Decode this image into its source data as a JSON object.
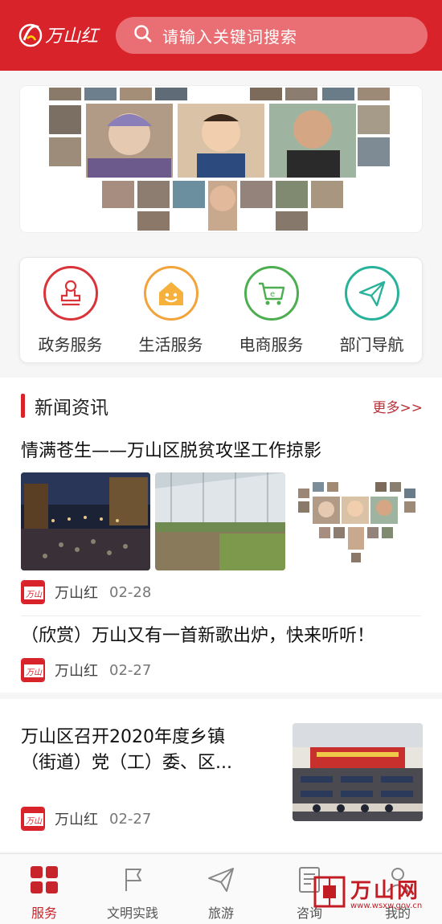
{
  "header": {
    "logo_text": "万山红",
    "search_placeholder": "请输入关键词搜索"
  },
  "services": [
    {
      "label": "政务服务",
      "icon": "stamp-icon",
      "color": "#d8343a"
    },
    {
      "label": "生活服务",
      "icon": "home-smile-icon",
      "color": "#f2a33a"
    },
    {
      "label": "电商服务",
      "icon": "cart-icon",
      "color": "#4cae4f"
    },
    {
      "label": "部门导航",
      "icon": "paper-plane-icon",
      "color": "#29b29a"
    }
  ],
  "news": {
    "section_title": "新闻资讯",
    "more_label": "更多>>",
    "articles": [
      {
        "title": "情满苍生——万山区脱贫攻坚工作掠影",
        "source": "万山红",
        "date": "02-28"
      },
      {
        "title": "（欣赏）万山又有一首新歌出炉，快来听听！",
        "source": "万山红",
        "date": "02-27"
      },
      {
        "title_line1": "万山区召开2020年度乡镇",
        "title_line2": "（街道）党（工）委、区...",
        "source": "万山红",
        "date": "02-27"
      }
    ]
  },
  "tabs": [
    {
      "label": "服务",
      "icon": "grid-icon",
      "active": true
    },
    {
      "label": "文明实践",
      "icon": "flag-icon",
      "active": false
    },
    {
      "label": "旅游",
      "icon": "paper-plane-icon",
      "active": false
    },
    {
      "label": "咨询",
      "icon": "document-icon",
      "active": false
    },
    {
      "label": "我的",
      "icon": "user-icon",
      "active": false
    }
  ],
  "watermark": {
    "name": "万山网",
    "url": "www.wsxw.gov.cn"
  },
  "colors": {
    "brand_red": "#d8232a",
    "text_dark": "#222222"
  }
}
